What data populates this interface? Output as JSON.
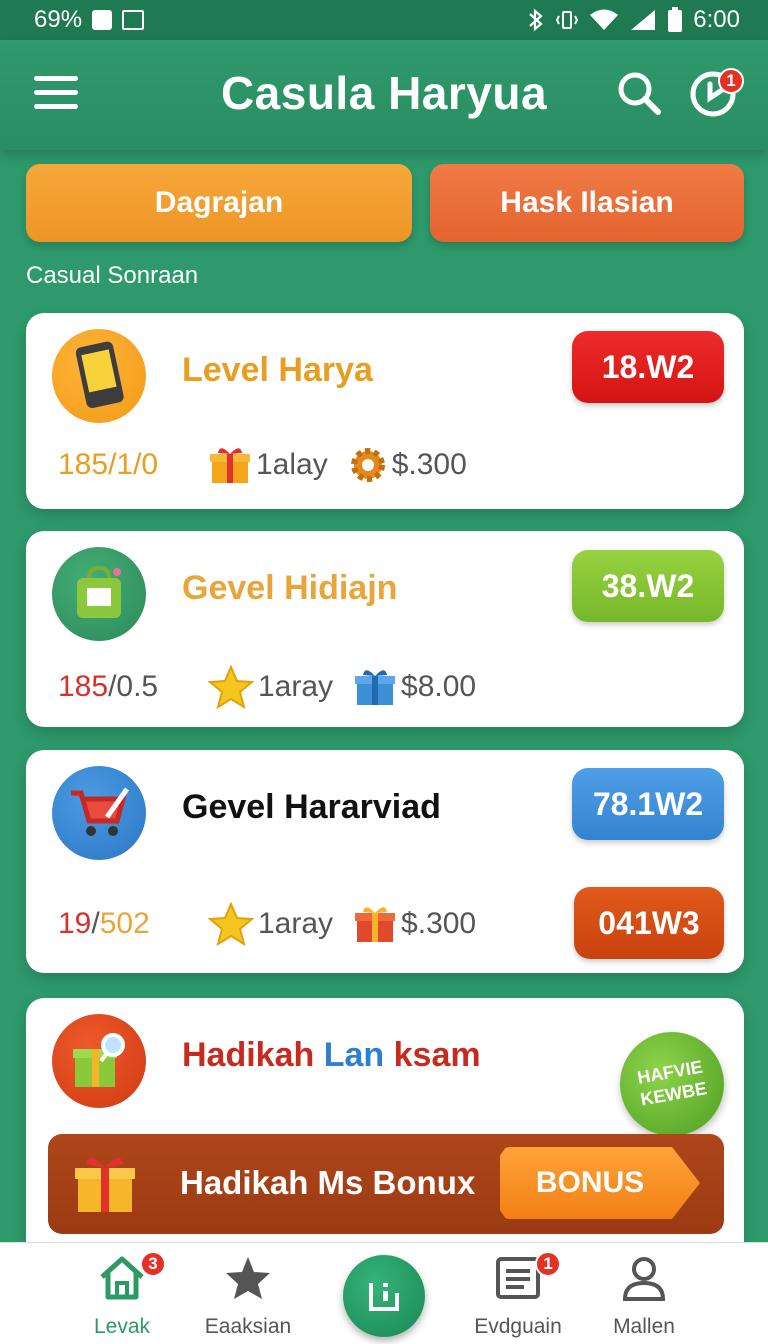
{
  "status_bar": {
    "battery_left": "69%",
    "time": "6:00"
  },
  "app": {
    "title": "Casula Haryua",
    "notification_count": "1"
  },
  "top_buttons": {
    "left": "Dagrajan",
    "right": "Hask Ilasian"
  },
  "section_label": "Casual Sonraan",
  "cards": [
    {
      "title": "Level Harya",
      "pill": "18.W2",
      "score_a": "185",
      "score_sep": "/",
      "score_b": "1/0",
      "reward1": "1alay",
      "reward2": "$.300",
      "icons": [
        "phone-icon",
        "gift-icon",
        "gear-icon"
      ]
    },
    {
      "title": "Gevel Hidiajn",
      "pill": "38.W2",
      "score_a": "185",
      "score_sep": "/",
      "score_b": "0.5",
      "reward1": "1aray",
      "reward2": "$8.00",
      "icons": [
        "bag-icon",
        "star-icon",
        "gift-icon"
      ]
    },
    {
      "title": "Gevel Hararviad",
      "pill": "78.1W2",
      "pill2": "041W3",
      "score_a": "19",
      "score_sep": "/",
      "score_b": "502",
      "reward1": "1aray",
      "reward2": "$.300",
      "icons": [
        "cart-icon",
        "star-icon",
        "gift-icon"
      ]
    }
  ],
  "bonus_card": {
    "title_part1": "Hadikah",
    "title_part2": "Lan",
    "title_part3": "ksam",
    "sticker_line1": "HAFVIE",
    "sticker_line2": "KEWBE",
    "banner_text": "Hadikah Ms Bonux",
    "banner_button": "BONUS"
  },
  "bottom_nav": {
    "items": [
      {
        "label": "Levak",
        "badge": "3",
        "icon": "home-icon"
      },
      {
        "label": "Eaaksian",
        "icon": "star-icon"
      },
      {
        "label": "",
        "icon": "center-icon"
      },
      {
        "label": "Evdguain",
        "badge": "1",
        "icon": "news-icon"
      },
      {
        "label": "Mallen",
        "icon": "user-icon"
      }
    ]
  },
  "colors": {
    "primary": "#2e9a6c",
    "orange": "#f6a83a",
    "red_orange": "#e3642f",
    "pill_red": "#e31c1c",
    "pill_green": "#86c832",
    "pill_blue": "#3d90dc",
    "pill_orange": "#d84e14"
  }
}
